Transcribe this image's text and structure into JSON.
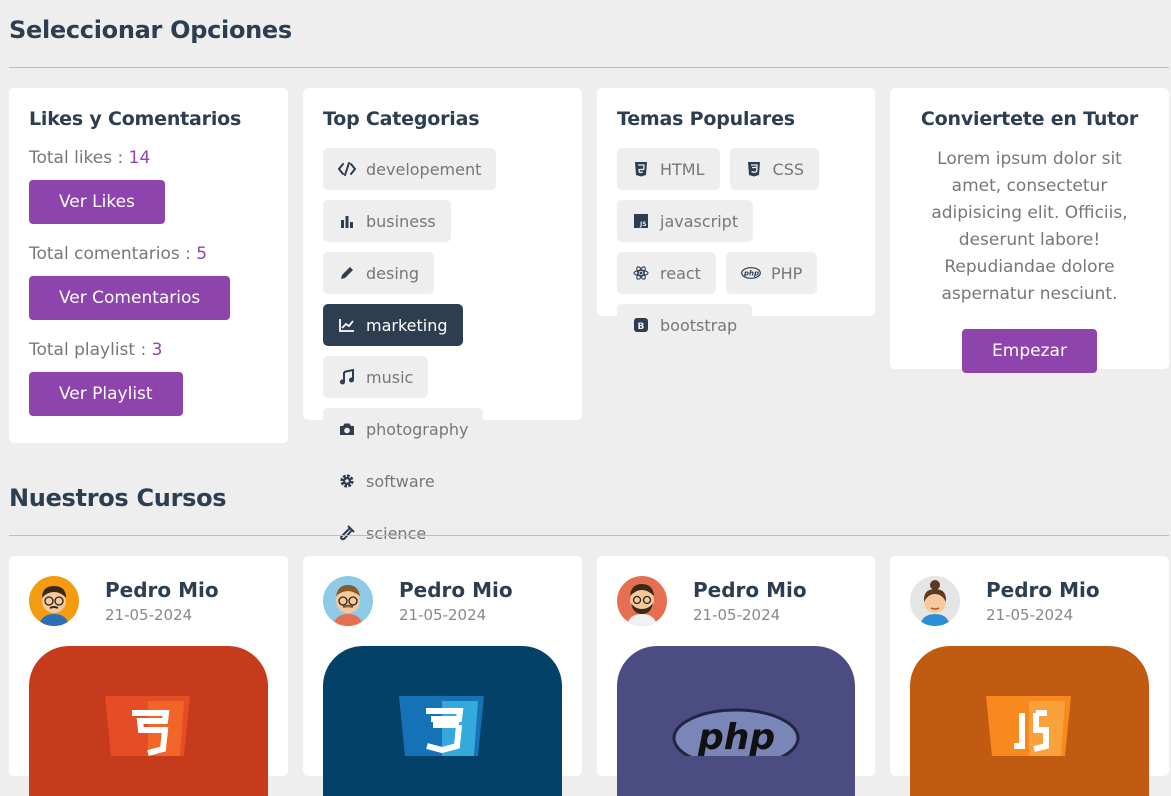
{
  "options_title": "Seleccionar Opciones",
  "likes": {
    "title": "Likes y Comentarios",
    "likes_label": "Total likes :",
    "likes_value": "14",
    "likes_button": "Ver Likes",
    "comments_label": "Total comentarios :",
    "comments_value": "5",
    "comments_button": "Ver Comentarios",
    "playlist_label": "Total playlist :",
    "playlist_value": "3",
    "playlist_button": "Ver Playlist"
  },
  "categories": {
    "title": "Top Categorias",
    "items": [
      {
        "label": "developement",
        "icon": "code-icon"
      },
      {
        "label": "business",
        "icon": "chart-bar-icon"
      },
      {
        "label": "desing",
        "icon": "pencil-icon"
      },
      {
        "label": "marketing",
        "icon": "chart-line-icon",
        "active": true
      },
      {
        "label": "music",
        "icon": "music-icon"
      },
      {
        "label": "photography",
        "icon": "camera-icon"
      },
      {
        "label": "software",
        "icon": "cog-icon"
      },
      {
        "label": "science",
        "icon": "vial-icon"
      }
    ]
  },
  "topics": {
    "title": "Temas Populares",
    "items": [
      {
        "label": "HTML",
        "icon": "html5-icon"
      },
      {
        "label": "CSS",
        "icon": "css3-icon"
      },
      {
        "label": "javascript",
        "icon": "js-icon"
      },
      {
        "label": "react",
        "icon": "react-icon"
      },
      {
        "label": "PHP",
        "icon": "php-icon"
      },
      {
        "label": "bootstrap",
        "icon": "bootstrap-icon"
      }
    ]
  },
  "tutor": {
    "title": "Conviertete en Tutor",
    "text": "Lorem ipsum dolor sit amet, consectetur adipisicing elit. Officiis, deserunt labore! Repudiandae dolore aspernatur nesciunt.",
    "button": "Empezar"
  },
  "courses_title": "Nuestros Cursos",
  "courses": [
    {
      "name": "Pedro Mio",
      "date": "21-05-2024",
      "thumb": "html5-thumbnail"
    },
    {
      "name": "Pedro Mio",
      "date": "21-05-2024",
      "thumb": "css3-thumbnail"
    },
    {
      "name": "Pedro Mio",
      "date": "21-05-2024",
      "thumb": "php-thumbnail"
    },
    {
      "name": "Pedro Mio",
      "date": "21-05-2024",
      "thumb": "js-thumbnail"
    }
  ],
  "colors": {
    "accent": "#8e44ad",
    "dark": "#2c3e50",
    "background": "#eeeeee"
  }
}
